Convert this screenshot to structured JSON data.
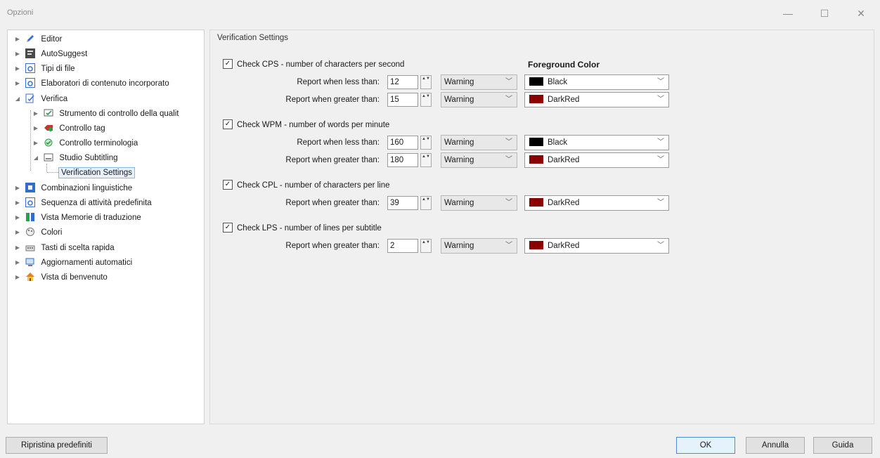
{
  "window": {
    "title": "Opzioni",
    "minimize_glyph": "—",
    "maximize_glyph": "☐",
    "close_glyph": "✕"
  },
  "tree": {
    "items": [
      {
        "label": "Editor",
        "icon": "pencil-icon",
        "expander": "▶"
      },
      {
        "label": "AutoSuggest",
        "icon": "autosuggest-icon",
        "expander": "▶"
      },
      {
        "label": "Tipi di file",
        "icon": "file-types-icon",
        "expander": "▶"
      },
      {
        "label": "Elaboratori di contenuto incorporato",
        "icon": "embedded-content-icon",
        "expander": "▶"
      },
      {
        "label": "Verifica",
        "icon": "verification-icon",
        "expander": "◢"
      },
      {
        "label": "Strumento di controllo della qualit",
        "icon": "qa-checker-icon",
        "expander": "▶"
      },
      {
        "label": "Controllo tag",
        "icon": "tag-check-icon",
        "expander": "▶"
      },
      {
        "label": "Controllo terminologia",
        "icon": "terminology-check-icon",
        "expander": "▶"
      },
      {
        "label": "Studio Subtitling",
        "icon": "subtitling-icon",
        "expander": "◢"
      },
      {
        "label": "Verification Settings",
        "icon": "",
        "expander": ""
      },
      {
        "label": "Combinazioni linguistiche",
        "icon": "language-pairs-icon",
        "expander": "▶"
      },
      {
        "label": "Sequenza di attività predefinita",
        "icon": "task-sequence-icon",
        "expander": "▶"
      },
      {
        "label": "Vista Memorie di traduzione",
        "icon": "tm-view-icon",
        "expander": "▶"
      },
      {
        "label": "Colori",
        "icon": "colors-icon",
        "expander": "▶"
      },
      {
        "label": "Tasti di scelta rapida",
        "icon": "keyboard-icon",
        "expander": "▶"
      },
      {
        "label": "Aggiornamenti automatici",
        "icon": "auto-update-icon",
        "expander": "▶"
      },
      {
        "label": "Vista di benvenuto",
        "icon": "welcome-icon",
        "expander": "▶"
      }
    ]
  },
  "panel": {
    "section_title": "Verification Settings",
    "fg_header": "Foreground Color",
    "spin_glyph": "▲▼",
    "chevron_glyph": "﹀",
    "checked_glyph": "✓",
    "colors": {
      "black": "#000000",
      "darkred": "#8b0000"
    },
    "checks": [
      {
        "label": "Check CPS - number of characters per second",
        "checked": true
      },
      {
        "label": "Check WPM - number of words per minute",
        "checked": true
      },
      {
        "label": "Check CPL - number of characters per line",
        "checked": true
      },
      {
        "label": "Check LPS - number of lines per subtitle",
        "checked": true
      }
    ],
    "rows": [
      {
        "label": "Report when less than:",
        "value": "12",
        "level": "Warning",
        "color_name": "Black",
        "color": "#000000"
      },
      {
        "label": "Report when greater than:",
        "value": "15",
        "level": "Warning",
        "color_name": "DarkRed",
        "color": "#8b0000"
      },
      {
        "label": "Report when less than:",
        "value": "160",
        "level": "Warning",
        "color_name": "Black",
        "color": "#000000"
      },
      {
        "label": "Report when greater than:",
        "value": "180",
        "level": "Warning",
        "color_name": "DarkRed",
        "color": "#8b0000"
      },
      {
        "label": "Report when greater than:",
        "value": "39",
        "level": "Warning",
        "color_name": "DarkRed",
        "color": "#8b0000"
      },
      {
        "label": "Report when greater than:",
        "value": "2",
        "level": "Warning",
        "color_name": "DarkRed",
        "color": "#8b0000"
      }
    ]
  },
  "footer": {
    "reset_label": "Ripristina predefiniti",
    "ok_label": "OK",
    "cancel_label": "Annulla",
    "help_label": "Guida"
  }
}
